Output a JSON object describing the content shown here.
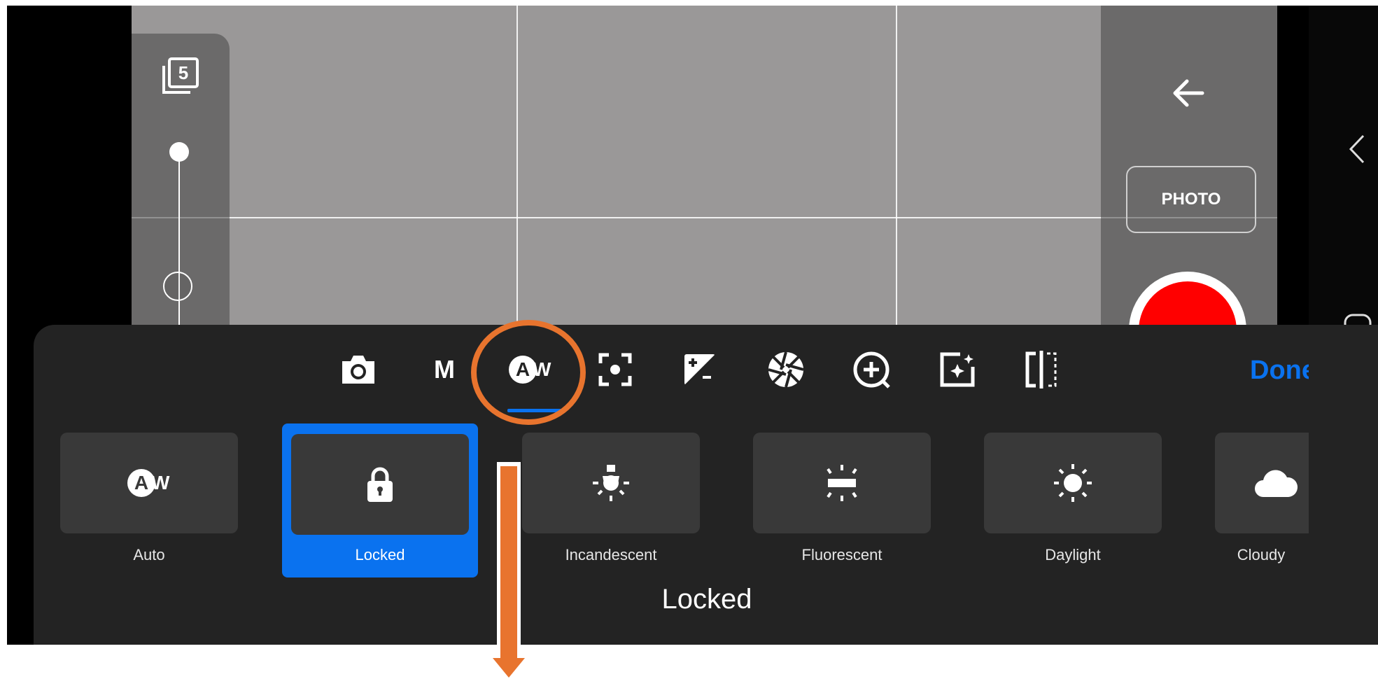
{
  "camera": {
    "gallery_count": "5",
    "mode_button": "PHOTO"
  },
  "tabs": [
    {
      "name": "camera-icon"
    },
    {
      "name": "manual",
      "label": "M"
    },
    {
      "name": "white-balance",
      "badge": "A",
      "suffix": "W",
      "selected": true
    },
    {
      "name": "focus-icon"
    },
    {
      "name": "exposure-icon"
    },
    {
      "name": "aperture-icon"
    },
    {
      "name": "zoom-plus-icon"
    },
    {
      "name": "enhance-icon"
    },
    {
      "name": "compare-icon"
    }
  ],
  "done_label": "Done",
  "white_balance": {
    "options": [
      {
        "label": "Auto",
        "badge": "A",
        "suffix": "W"
      },
      {
        "label": "Locked"
      },
      {
        "label": "Incandescent"
      },
      {
        "label": "Fluorescent"
      },
      {
        "label": "Daylight"
      },
      {
        "label": "Cloudy"
      }
    ],
    "selected": "Locked",
    "current_label": "Locked"
  },
  "colors": {
    "accent_blue": "#0a72ef",
    "annotation_orange": "#e8742e",
    "record_red": "#ff0000"
  }
}
